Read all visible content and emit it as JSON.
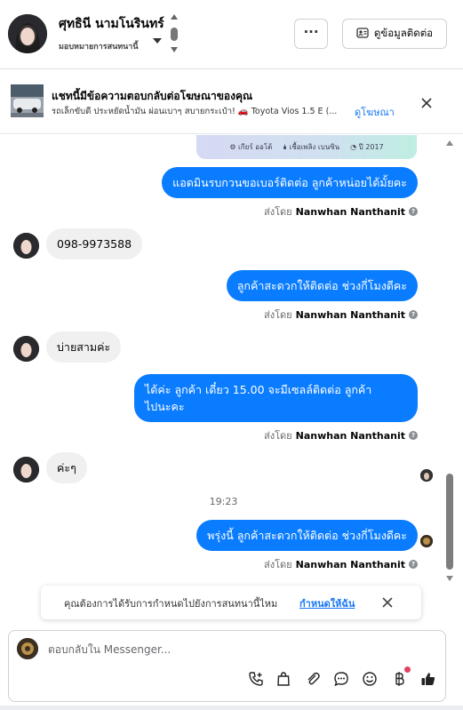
{
  "header": {
    "contact_name": "ศุทธินี นามโนรินทร์",
    "assign_label": "มอบหมายการสนทนานี้",
    "more_label": "···",
    "contact_info_label": "ดูข้อมูลติดต่อ"
  },
  "ad_banner": {
    "title": "แชทนี้มีข้อความตอบกลับต่อโฆษณาของคุณ",
    "subtitle": "รถเล็กขับดี ประหยัดน้ำมัน ผ่อนเบาๆ สบายกระเป๋า! 🚗 Toyota Vios 1.5 E (...",
    "link_label": "ดูโฆษณา"
  },
  "card_fragment": {
    "gear": "⚙ เกียร์ ออโต้",
    "fuel": "🌢 เชื้อเพลิง เบนซิน",
    "year": "◔ ปี 2017"
  },
  "messages": {
    "m1": "แอดมินรบกวนขอเบอร์ติดต่อ ลูกค้าหน่อยได้มั้ยคะ",
    "m2": "098-9973588",
    "m3": "ลูกค้าสะดวกให้ติดต่อ ช่วงกี่โมงดีคะ",
    "m4": "บ่ายสามค่ะ",
    "m5_line1": "ได้ค่ะ  ลูกค้า  เดี๋ยว  15.00 จะมีเซลล์ติดต่อ ลูกค้า",
    "m5_line2": "ไปนะคะ",
    "m6": "ค่ะๆ",
    "m7": "พรุ่งนี้ ลูกค้าสะดวกให้ติดต่อ ช่วงกี่โมงดีคะ"
  },
  "sent_by": {
    "prefix": "ส่งโดย",
    "name": "Nanwhan Nanthanit"
  },
  "timestamp": "19:23",
  "assign_prompt": {
    "question": "คุณต้องการได้รับการกำหนดไปยังการสนทนานี้ไหม",
    "link": "กำหนดให้ฉัน"
  },
  "composer": {
    "placeholder": "ตอบกลับใน Messenger..."
  },
  "colors": {
    "outgoing_bubble": "#0a7cff",
    "incoming_bubble": "#f0f0f0",
    "link": "#1877f2"
  }
}
